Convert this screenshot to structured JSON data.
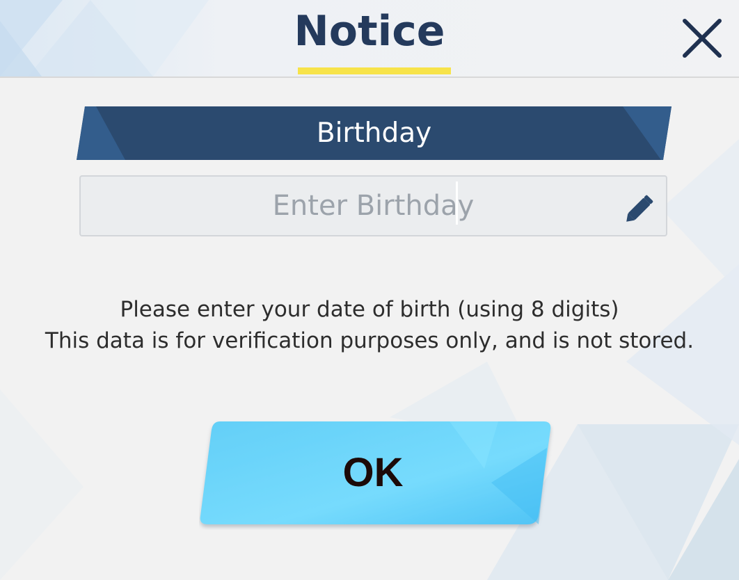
{
  "dialog": {
    "title": "Notice",
    "close_icon": "close-icon",
    "field_label": "Birthday",
    "input": {
      "placeholder": "Enter Birthday",
      "value": "",
      "edit_icon": "pencil-icon"
    },
    "message_lines": [
      "Please enter your date of birth (using 8 digits)",
      "This data is for verification purposes only, and is not stored."
    ],
    "ok_label": "OK"
  },
  "colors": {
    "title": "#243a5c",
    "underline": "#f7e34a",
    "banner": "#2b4a6f",
    "ok_button": "#6fd6fb"
  }
}
